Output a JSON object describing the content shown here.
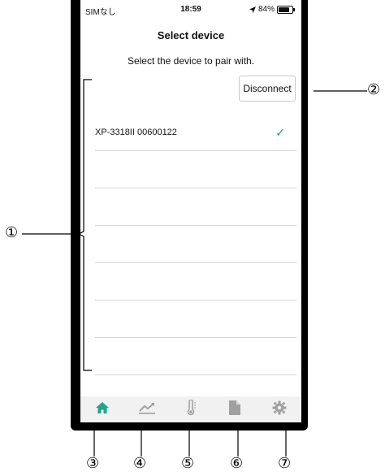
{
  "status_bar": {
    "carrier": "SIMなし",
    "time": "18:59",
    "battery": "84%",
    "battery_level": 0.84
  },
  "header": {
    "title": "Select device"
  },
  "instructions": "Select the device to pair with.",
  "disconnect_button": "Disconnect",
  "devices": [
    {
      "name": "XP-3318II 00600122",
      "selected": true
    },
    {
      "name": ""
    },
    {
      "name": ""
    },
    {
      "name": ""
    },
    {
      "name": ""
    },
    {
      "name": ""
    },
    {
      "name": ""
    }
  ],
  "tabs": [
    {
      "icon": "home-icon",
      "active": true
    },
    {
      "icon": "chart-icon"
    },
    {
      "icon": "thermometer-icon"
    },
    {
      "icon": "document-icon"
    },
    {
      "icon": "gear-icon"
    }
  ],
  "callouts": [
    "①",
    "②",
    "③",
    "④",
    "⑤",
    "⑥",
    "⑦"
  ],
  "colors": {
    "accent": "#22a58a",
    "inactive_icon": "#a0a0a0",
    "tabbar_bg": "#f1f1f1"
  }
}
